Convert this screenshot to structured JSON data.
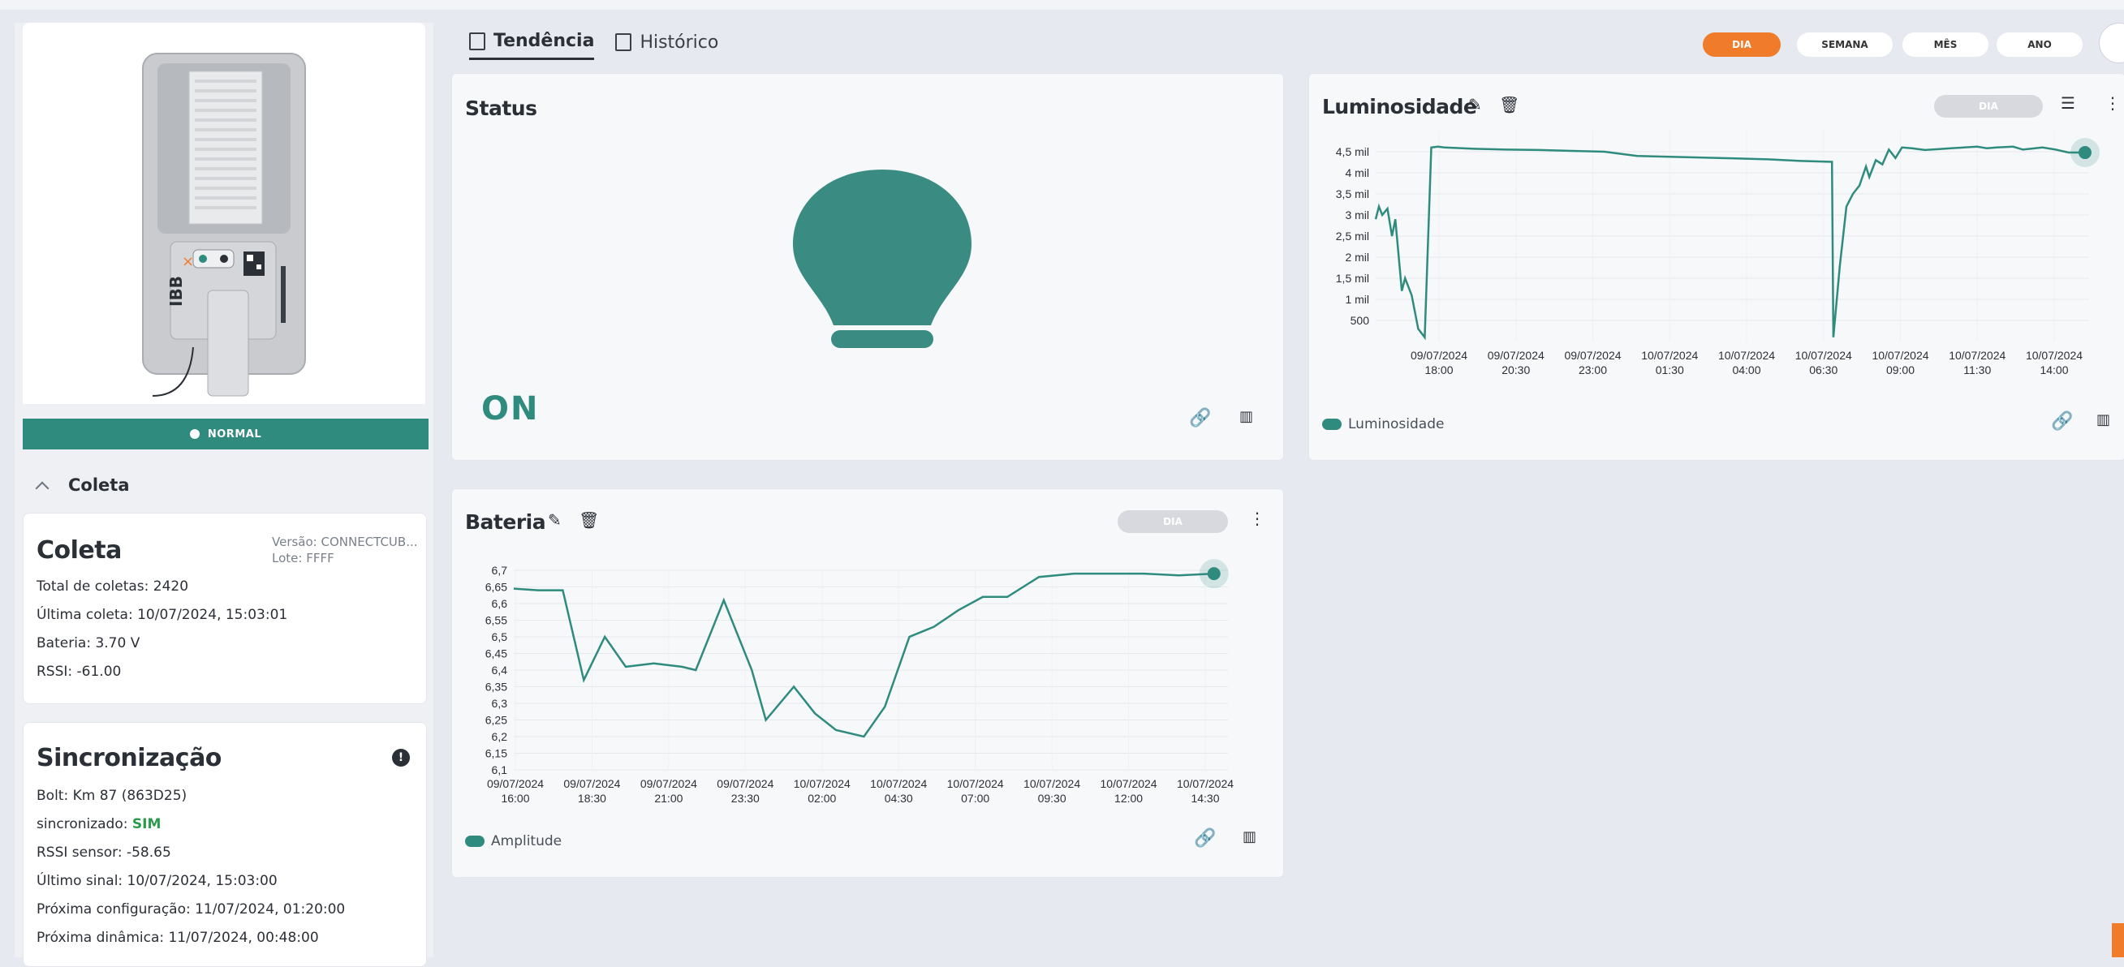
{
  "tabs": [
    {
      "label": "Tendência",
      "active": true
    },
    {
      "label": "Histórico",
      "active": false
    }
  ],
  "periods": {
    "dia": "DIA",
    "semana": "SEMANA",
    "mes": "MÊS",
    "ano": "ANO",
    "selected": "DIA"
  },
  "device": {
    "status": "NORMAL",
    "brand": "IBB",
    "section_label": "Coleta"
  },
  "coleta": {
    "title": "Coleta",
    "versao": "Versão: CONNECTCUB...",
    "lote": "Lote: FFFF",
    "total": "Total de coletas: 2420",
    "ultima": "Última coleta: 10/07/2024, 15:03:01",
    "bateria": "Bateria: 3.70 V",
    "rssi": "RSSI: -61.00"
  },
  "sincronizacao": {
    "title": "Sincronização",
    "bolt": "Bolt: Km 87 (863D25)",
    "sincronizado_label": "sincronizado:",
    "sincronizado_value": "SIM",
    "rssi_sensor": "RSSI sensor: -58.65",
    "ultimo_sinal": "Último sinal: 10/07/2024, 15:03:00",
    "proxima_config": "Próxima configuração: 11/07/2024, 01:20:00",
    "proxima_dinamica": "Próxima dinâmica: 11/07/2024, 00:48:00"
  },
  "status_widget": {
    "title": "Status",
    "value": "ON"
  },
  "luminosidade_widget": {
    "title": "Luminosidade",
    "pill": "DIA"
  },
  "bateria_widget": {
    "title": "Bateria",
    "pill": "DIA"
  },
  "colors": {
    "accent": "#2e8b7e",
    "orange": "#f07b2b"
  },
  "chart_data": [
    {
      "type": "line",
      "ylabel": "",
      "y_ticks": [
        "500",
        "1 mil",
        "1,5 mil",
        "2 mil",
        "2,5 mil",
        "3 mil",
        "3,5 mil",
        "4 mil",
        "4,5 mil"
      ],
      "x_ticks": [
        "09/07/2024 18:00",
        "09/07/2024 20:30",
        "09/07/2024 23:00",
        "10/07/2024 01:30",
        "10/07/2024 04:00",
        "10/07/2024 06:30",
        "10/07/2024 09:00",
        "10/07/2024 11:30",
        "10/07/2024 14:00"
      ],
      "ylim": [
        0,
        5000
      ],
      "series": [
        {
          "name": "Luminosidade",
          "x": [
            0,
            0.05,
            0.1,
            0.18,
            0.25,
            0.3,
            0.4,
            0.45,
            0.55,
            0.65,
            0.75,
            0.85,
            0.95,
            1.0,
            1.05,
            1.5,
            2.0,
            2.5,
            3.0,
            3.5,
            4.0,
            4.5,
            5.0,
            5.5,
            6.0,
            6.5,
            6.98,
            7.0,
            7.1,
            7.2,
            7.3,
            7.4,
            7.5,
            7.55,
            7.65,
            7.75,
            7.85,
            7.95,
            8.05,
            8.2,
            8.4,
            8.6,
            8.8,
            9.0,
            9.2,
            9.35,
            9.5,
            9.75,
            9.9,
            10.2,
            10.4,
            10.6,
            10.85
          ],
          "y": [
            2900,
            3200,
            3000,
            3150,
            2500,
            2900,
            1200,
            1500,
            1100,
            300,
            100,
            4600,
            4620,
            4610,
            4600,
            4570,
            4550,
            4540,
            4520,
            4500,
            4400,
            4380,
            4360,
            4340,
            4320,
            4280,
            4260,
            100,
            1800,
            3200,
            3500,
            3700,
            4150,
            3900,
            4300,
            4200,
            4550,
            4350,
            4600,
            4580,
            4540,
            4560,
            4580,
            4600,
            4620,
            4580,
            4600,
            4620,
            4550,
            4600,
            4550,
            4480,
            4480
          ]
        }
      ]
    },
    {
      "type": "line",
      "y_ticks": [
        "6,1",
        "6,15",
        "6,2",
        "6,25",
        "6,3",
        "6,35",
        "6,4",
        "6,45",
        "6,5",
        "6,55",
        "6,6",
        "6,65",
        "6,7"
      ],
      "x_ticks": [
        "09/07/2024 16:00",
        "09/07/2024 18:30",
        "09/07/2024 21:00",
        "09/07/2024 23:30",
        "10/07/2024 02:00",
        "10/07/2024 04:30",
        "10/07/2024 07:00",
        "10/07/2024 09:30",
        "10/07/2024 12:00",
        "10/07/2024 14:30"
      ],
      "ylim": [
        6.1,
        6.7
      ],
      "series": [
        {
          "name": "Amplitude",
          "x": [
            0,
            0.7,
            1.4,
            2.0,
            2.6,
            3.2,
            4.0,
            4.8,
            5.2,
            6.0,
            6.8,
            7.2,
            8.0,
            8.6,
            9.2,
            10.0,
            10.6,
            11.3,
            12.0,
            12.7,
            13.4,
            14.1,
            15.0,
            16.0,
            17.0,
            18.0,
            19.0,
            20.0
          ],
          "y": [
            6.645,
            6.64,
            6.64,
            6.37,
            6.5,
            6.41,
            6.42,
            6.41,
            6.4,
            6.61,
            6.4,
            6.25,
            6.35,
            6.27,
            6.22,
            6.2,
            6.29,
            6.5,
            6.53,
            6.58,
            6.62,
            6.62,
            6.68,
            6.69,
            6.69,
            6.69,
            6.685,
            6.69
          ]
        }
      ]
    }
  ]
}
